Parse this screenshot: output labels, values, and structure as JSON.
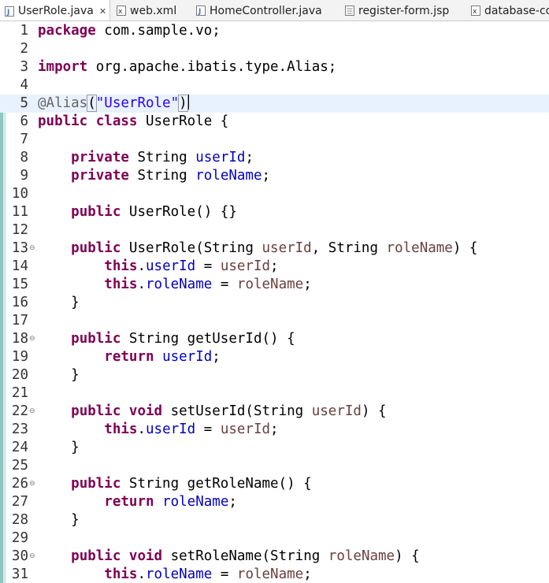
{
  "tabs": [
    {
      "label": "UserRole.java",
      "icon": "java-file-icon",
      "active": true,
      "close": "✕"
    },
    {
      "label": "web.xml",
      "icon": "xml-file-icon",
      "active": false
    },
    {
      "label": "HomeController.java",
      "icon": "java-file-icon",
      "active": false
    },
    {
      "label": "register-form.jsp",
      "icon": "jsp-file-icon",
      "active": false
    },
    {
      "label": "database-co",
      "icon": "xml-file-icon",
      "active": false
    }
  ],
  "editor": {
    "current_line": 5,
    "lines": [
      {
        "n": "1",
        "fold": "",
        "tokens": [
          [
            "kw",
            "package"
          ],
          [
            "plain",
            " com.sample.vo;"
          ]
        ]
      },
      {
        "n": "2",
        "fold": "",
        "tokens": []
      },
      {
        "n": "3",
        "fold": "",
        "tokens": [
          [
            "kw",
            "import"
          ],
          [
            "plain",
            " org.apache.ibatis.type.Alias;"
          ]
        ]
      },
      {
        "n": "4",
        "fold": "",
        "tokens": []
      },
      {
        "n": "5",
        "fold": "",
        "tokens": [
          [
            "anno",
            "@Alias"
          ],
          [
            "bracket",
            "("
          ],
          [
            "str",
            "\"UserRole\""
          ],
          [
            "bracket",
            ")"
          ],
          [
            "caret",
            ""
          ]
        ]
      },
      {
        "n": "6",
        "fold": "",
        "tokens": [
          [
            "kw",
            "public"
          ],
          [
            "plain",
            " "
          ],
          [
            "kw",
            "class"
          ],
          [
            "plain",
            " UserRole {"
          ]
        ]
      },
      {
        "n": "7",
        "fold": "",
        "tokens": []
      },
      {
        "n": "8",
        "fold": "",
        "tokens": [
          [
            "plain",
            "    "
          ],
          [
            "kw",
            "private"
          ],
          [
            "plain",
            " String "
          ],
          [
            "field",
            "userId"
          ],
          [
            "plain",
            ";"
          ]
        ]
      },
      {
        "n": "9",
        "fold": "",
        "tokens": [
          [
            "plain",
            "    "
          ],
          [
            "kw",
            "private"
          ],
          [
            "plain",
            " String "
          ],
          [
            "field",
            "roleName"
          ],
          [
            "plain",
            ";"
          ]
        ]
      },
      {
        "n": "10",
        "fold": "",
        "tokens": []
      },
      {
        "n": "11",
        "fold": "",
        "tokens": [
          [
            "plain",
            "    "
          ],
          [
            "kw",
            "public"
          ],
          [
            "plain",
            " UserRole() {}"
          ]
        ]
      },
      {
        "n": "12",
        "fold": "",
        "tokens": []
      },
      {
        "n": "13",
        "fold": "⊖",
        "tokens": [
          [
            "plain",
            "    "
          ],
          [
            "kw",
            "public"
          ],
          [
            "plain",
            " UserRole(String "
          ],
          [
            "param",
            "userId"
          ],
          [
            "plain",
            ", String "
          ],
          [
            "param",
            "roleName"
          ],
          [
            "plain",
            ") {"
          ]
        ]
      },
      {
        "n": "14",
        "fold": "",
        "tokens": [
          [
            "plain",
            "        "
          ],
          [
            "kw",
            "this"
          ],
          [
            "plain",
            "."
          ],
          [
            "field",
            "userId"
          ],
          [
            "plain",
            " = "
          ],
          [
            "param",
            "userId"
          ],
          [
            "plain",
            ";"
          ]
        ]
      },
      {
        "n": "15",
        "fold": "",
        "tokens": [
          [
            "plain",
            "        "
          ],
          [
            "kw",
            "this"
          ],
          [
            "plain",
            "."
          ],
          [
            "field",
            "roleName"
          ],
          [
            "plain",
            " = "
          ],
          [
            "param",
            "roleName"
          ],
          [
            "plain",
            ";"
          ]
        ]
      },
      {
        "n": "16",
        "fold": "",
        "tokens": [
          [
            "plain",
            "    }"
          ]
        ]
      },
      {
        "n": "17",
        "fold": "",
        "tokens": []
      },
      {
        "n": "18",
        "fold": "⊖",
        "tokens": [
          [
            "plain",
            "    "
          ],
          [
            "kw",
            "public"
          ],
          [
            "plain",
            " String getUserId() {"
          ]
        ]
      },
      {
        "n": "19",
        "fold": "",
        "tokens": [
          [
            "plain",
            "        "
          ],
          [
            "kw",
            "return"
          ],
          [
            "plain",
            " "
          ],
          [
            "field",
            "userId"
          ],
          [
            "plain",
            ";"
          ]
        ]
      },
      {
        "n": "20",
        "fold": "",
        "tokens": [
          [
            "plain",
            "    }"
          ]
        ]
      },
      {
        "n": "21",
        "fold": "",
        "tokens": []
      },
      {
        "n": "22",
        "fold": "⊖",
        "tokens": [
          [
            "plain",
            "    "
          ],
          [
            "kw",
            "public"
          ],
          [
            "plain",
            " "
          ],
          [
            "kw",
            "void"
          ],
          [
            "plain",
            " setUserId(String "
          ],
          [
            "param",
            "userId"
          ],
          [
            "plain",
            ") {"
          ]
        ]
      },
      {
        "n": "23",
        "fold": "",
        "tokens": [
          [
            "plain",
            "        "
          ],
          [
            "kw",
            "this"
          ],
          [
            "plain",
            "."
          ],
          [
            "field",
            "userId"
          ],
          [
            "plain",
            " = "
          ],
          [
            "param",
            "userId"
          ],
          [
            "plain",
            ";"
          ]
        ]
      },
      {
        "n": "24",
        "fold": "",
        "tokens": [
          [
            "plain",
            "    }"
          ]
        ]
      },
      {
        "n": "25",
        "fold": "",
        "tokens": []
      },
      {
        "n": "26",
        "fold": "⊖",
        "tokens": [
          [
            "plain",
            "    "
          ],
          [
            "kw",
            "public"
          ],
          [
            "plain",
            " String getRoleName() {"
          ]
        ]
      },
      {
        "n": "27",
        "fold": "",
        "tokens": [
          [
            "plain",
            "        "
          ],
          [
            "kw",
            "return"
          ],
          [
            "plain",
            " "
          ],
          [
            "field",
            "roleName"
          ],
          [
            "plain",
            ";"
          ]
        ]
      },
      {
        "n": "28",
        "fold": "",
        "tokens": [
          [
            "plain",
            "    }"
          ]
        ]
      },
      {
        "n": "29",
        "fold": "",
        "tokens": []
      },
      {
        "n": "30",
        "fold": "⊖",
        "tokens": [
          [
            "plain",
            "    "
          ],
          [
            "kw",
            "public"
          ],
          [
            "plain",
            " "
          ],
          [
            "kw",
            "void"
          ],
          [
            "plain",
            " setRoleName(String "
          ],
          [
            "param",
            "roleName"
          ],
          [
            "plain",
            ") {"
          ]
        ]
      },
      {
        "n": "31",
        "fold": "",
        "tokens": [
          [
            "plain",
            "        "
          ],
          [
            "kw",
            "this"
          ],
          [
            "plain",
            "."
          ],
          [
            "field",
            "roleName"
          ],
          [
            "plain",
            " = "
          ],
          [
            "param",
            "roleName"
          ],
          [
            "plain",
            ";"
          ]
        ]
      }
    ]
  },
  "colors": {
    "keyword": "#7f0055",
    "field": "#0000c0",
    "parameter": "#6a3e3e",
    "string": "#2a00ff",
    "annotation": "#646464",
    "current_line": "#e8f2fe",
    "change_ruler": "#8ec6c4"
  }
}
